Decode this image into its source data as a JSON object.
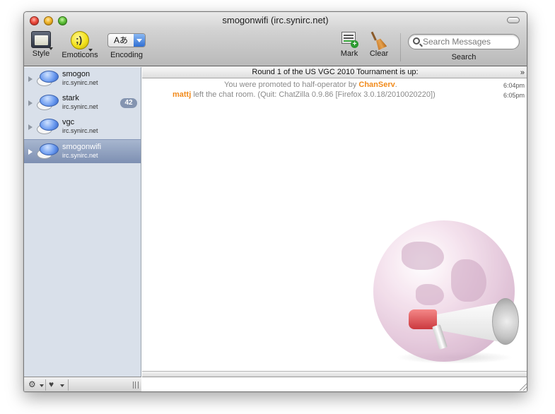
{
  "window": {
    "title": "smogonwifi (irc.synirc.net)"
  },
  "toolbar": {
    "style_label": "Style",
    "emoticons_label": "Emoticons",
    "encoding_label": "Encoding",
    "encoding_value": "Aあ",
    "mark_label": "Mark",
    "clear_label": "Clear",
    "search_placeholder": "Search Messages",
    "search_label": "Search"
  },
  "sidebar": {
    "items": [
      {
        "name": "smogon",
        "server": "irc.synirc.net",
        "badge": ""
      },
      {
        "name": "stark",
        "server": "irc.synirc.net",
        "badge": "42"
      },
      {
        "name": "vgc",
        "server": "irc.synirc.net",
        "badge": ""
      },
      {
        "name": "smogonwifi",
        "server": "irc.synirc.net",
        "badge": "",
        "selected": true
      }
    ],
    "footer": {
      "gear_glyph": "⚙",
      "heart_glyph": "♥"
    }
  },
  "chat": {
    "topic": "Round 1 of the US VGC 2010 Tournament is up:",
    "messages": [
      {
        "prefix": "You were promoted to half-operator by ",
        "nick": "ChanServ",
        "suffix": ".",
        "time": "6:04pm"
      },
      {
        "prefix": "",
        "nick": "mattj",
        "suffix": " left the chat room. (Quit: ChatZilla 0.9.86 [Firefox 3.0.18/2010020220])",
        "time": "6:05pm"
      }
    ],
    "input_value": ""
  },
  "colors": {
    "nick": "#f18a1b",
    "system_text": "#8a8a8a",
    "sidebar_bg": "#d9e0ea",
    "selected_row": "#7d8fb2",
    "badge": "#8494b0"
  },
  "icons": [
    "close-button",
    "minimize-button",
    "zoom-button",
    "style-icon",
    "emoticon-icon",
    "encoding-popup",
    "mark-icon",
    "broom-icon",
    "search-icon",
    "chat-bubble-icon",
    "gear-icon",
    "heart-icon",
    "globe-megaphone-icon"
  ]
}
